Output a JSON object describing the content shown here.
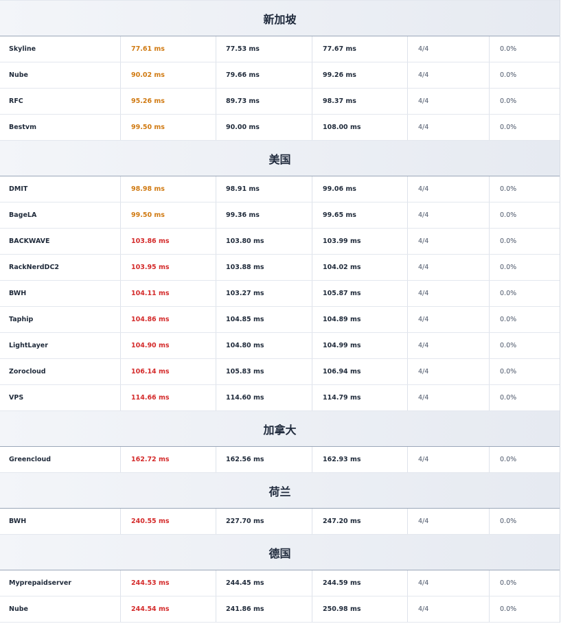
{
  "colors": {
    "avg_orange": "#d07a12",
    "avg_red": "#d42b2b"
  },
  "sections": [
    {
      "title": "新加坡",
      "rows": [
        {
          "name": "Skyline",
          "avg": "77.61 ms",
          "avg_color": "orange",
          "min": "77.53 ms",
          "max": "77.67 ms",
          "count": "4/4",
          "loss": "0.0%"
        },
        {
          "name": "Nube",
          "avg": "90.02 ms",
          "avg_color": "orange",
          "min": "79.66 ms",
          "max": "99.26 ms",
          "count": "4/4",
          "loss": "0.0%"
        },
        {
          "name": "RFC",
          "avg": "95.26 ms",
          "avg_color": "orange",
          "min": "89.73 ms",
          "max": "98.37 ms",
          "count": "4/4",
          "loss": "0.0%"
        },
        {
          "name": "Bestvm",
          "avg": "99.50 ms",
          "avg_color": "orange",
          "min": "90.00 ms",
          "max": "108.00 ms",
          "count": "4/4",
          "loss": "0.0%"
        }
      ]
    },
    {
      "title": "美国",
      "rows": [
        {
          "name": "DMIT",
          "avg": "98.98 ms",
          "avg_color": "orange",
          "min": "98.91 ms",
          "max": "99.06 ms",
          "count": "4/4",
          "loss": "0.0%"
        },
        {
          "name": "BageLA",
          "avg": "99.50 ms",
          "avg_color": "orange",
          "min": "99.36 ms",
          "max": "99.65 ms",
          "count": "4/4",
          "loss": "0.0%"
        },
        {
          "name": "BACKWAVE",
          "avg": "103.86 ms",
          "avg_color": "red",
          "min": "103.80 ms",
          "max": "103.99 ms",
          "count": "4/4",
          "loss": "0.0%"
        },
        {
          "name": "RackNerdDC2",
          "avg": "103.95 ms",
          "avg_color": "red",
          "min": "103.88 ms",
          "max": "104.02 ms",
          "count": "4/4",
          "loss": "0.0%"
        },
        {
          "name": "BWH",
          "avg": "104.11 ms",
          "avg_color": "red",
          "min": "103.27 ms",
          "max": "105.87 ms",
          "count": "4/4",
          "loss": "0.0%"
        },
        {
          "name": "Taphip",
          "avg": "104.86 ms",
          "avg_color": "red",
          "min": "104.85 ms",
          "max": "104.89 ms",
          "count": "4/4",
          "loss": "0.0%"
        },
        {
          "name": "LightLayer",
          "avg": "104.90 ms",
          "avg_color": "red",
          "min": "104.80 ms",
          "max": "104.99 ms",
          "count": "4/4",
          "loss": "0.0%"
        },
        {
          "name": "Zorocloud",
          "avg": "106.14 ms",
          "avg_color": "red",
          "min": "105.83 ms",
          "max": "106.94 ms",
          "count": "4/4",
          "loss": "0.0%"
        },
        {
          "name": "VPS",
          "avg": "114.66 ms",
          "avg_color": "red",
          "min": "114.60 ms",
          "max": "114.79 ms",
          "count": "4/4",
          "loss": "0.0%"
        }
      ]
    },
    {
      "title": "加拿大",
      "rows": [
        {
          "name": "Greencloud",
          "avg": "162.72 ms",
          "avg_color": "red",
          "min": "162.56 ms",
          "max": "162.93 ms",
          "count": "4/4",
          "loss": "0.0%"
        }
      ]
    },
    {
      "title": "荷兰",
      "rows": [
        {
          "name": "BWH",
          "avg": "240.55 ms",
          "avg_color": "red",
          "min": "227.70 ms",
          "max": "247.20 ms",
          "count": "4/4",
          "loss": "0.0%"
        }
      ]
    },
    {
      "title": "德国",
      "rows": [
        {
          "name": "Myprepaidserver",
          "avg": "244.53 ms",
          "avg_color": "red",
          "min": "244.45 ms",
          "max": "244.59 ms",
          "count": "4/4",
          "loss": "0.0%"
        },
        {
          "name": "Nube",
          "avg": "244.54 ms",
          "avg_color": "red",
          "min": "241.86 ms",
          "max": "250.98 ms",
          "count": "4/4",
          "loss": "0.0%"
        }
      ]
    }
  ]
}
